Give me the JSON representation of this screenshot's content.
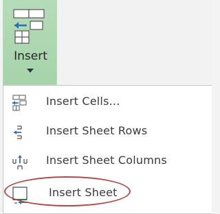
{
  "ribbon": {
    "insert_label": "Insert",
    "insert_icon": "insert-cells-icon"
  },
  "menu": {
    "items": [
      {
        "label": "Insert Cells...",
        "icon": "insert-cells-icon"
      },
      {
        "label": "Insert Sheet Rows",
        "icon": "insert-rows-icon"
      },
      {
        "label": "Insert Sheet Columns",
        "icon": "insert-columns-icon"
      },
      {
        "label": "Insert Sheet",
        "icon": "insert-sheet-icon",
        "highlighted": true
      }
    ]
  },
  "colors": {
    "ribbon_bg": "#a6d3aa",
    "highlight_ring": "#b04a46",
    "accent_blue": "#2f6fb7",
    "accent_green": "#2f7d3b"
  }
}
